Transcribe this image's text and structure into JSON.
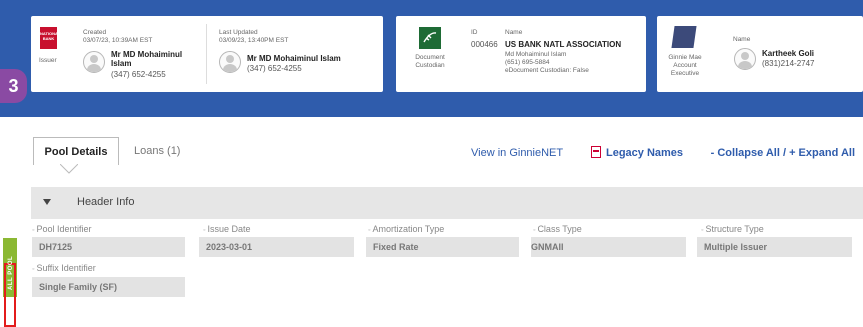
{
  "badge": "3",
  "issuer_card": {
    "logo_text": "NATIONAL BANK",
    "issuer_label": "Issuer",
    "created_label": "Created",
    "created_value": "03/07/23, 10:39AM EST",
    "created_name": "Mr MD Mohaiminul Islam",
    "created_phone": "(347) 652-4255",
    "updated_label": "Last Updated",
    "updated_value": "03/09/23, 13:40PM EST",
    "updated_name": "Mr MD Mohaiminul Islam",
    "updated_phone": "(347) 652-4255"
  },
  "custodian_card": {
    "label": "Document Custodian",
    "id_label": "ID",
    "id_value": "000466",
    "name_label": "Name",
    "name_value": "US BANK NATL ASSOCIATION",
    "contact": "Md Mohaiminul Islam",
    "phone": "(651) 695-5884",
    "ecustodian": "eDocument Custodian: False"
  },
  "ae_card": {
    "label": "Ginnie Mae Account Executive",
    "name_label": "Name",
    "name_value": "Kartheek Goli",
    "phone": "(831)214-2747"
  },
  "tabs": {
    "pool_details": "Pool Details",
    "loans": "Loans (1)",
    "view_ginnienet": "View in GinnieNET",
    "legacy_names": "Legacy Names",
    "collapse_expand": "- Collapse All / + Expand All"
  },
  "header_info": {
    "title": "Header Info",
    "fields": {
      "pool_identifier_label": "Pool Identifier",
      "pool_identifier": "DH7125",
      "issue_date_label": "Issue Date",
      "issue_date": "2023-03-01",
      "amortization_label": "Amortization Type",
      "amortization": "Fixed Rate",
      "class_type_label": "Class Type",
      "class_type": "GNMAII",
      "structure_type_label": "Structure Type",
      "structure_type": "Multiple Issuer",
      "suffix_label": "Suffix Identifier",
      "suffix": "Single Family (SF)"
    }
  },
  "side_tab": "ALL POOL",
  "colors": {
    "topbar": "#2f5cac",
    "link": "#2f5cac",
    "accent_green": "#8bb833",
    "badge": "#8a4aa3",
    "highlight_red": "#e31b1b"
  }
}
